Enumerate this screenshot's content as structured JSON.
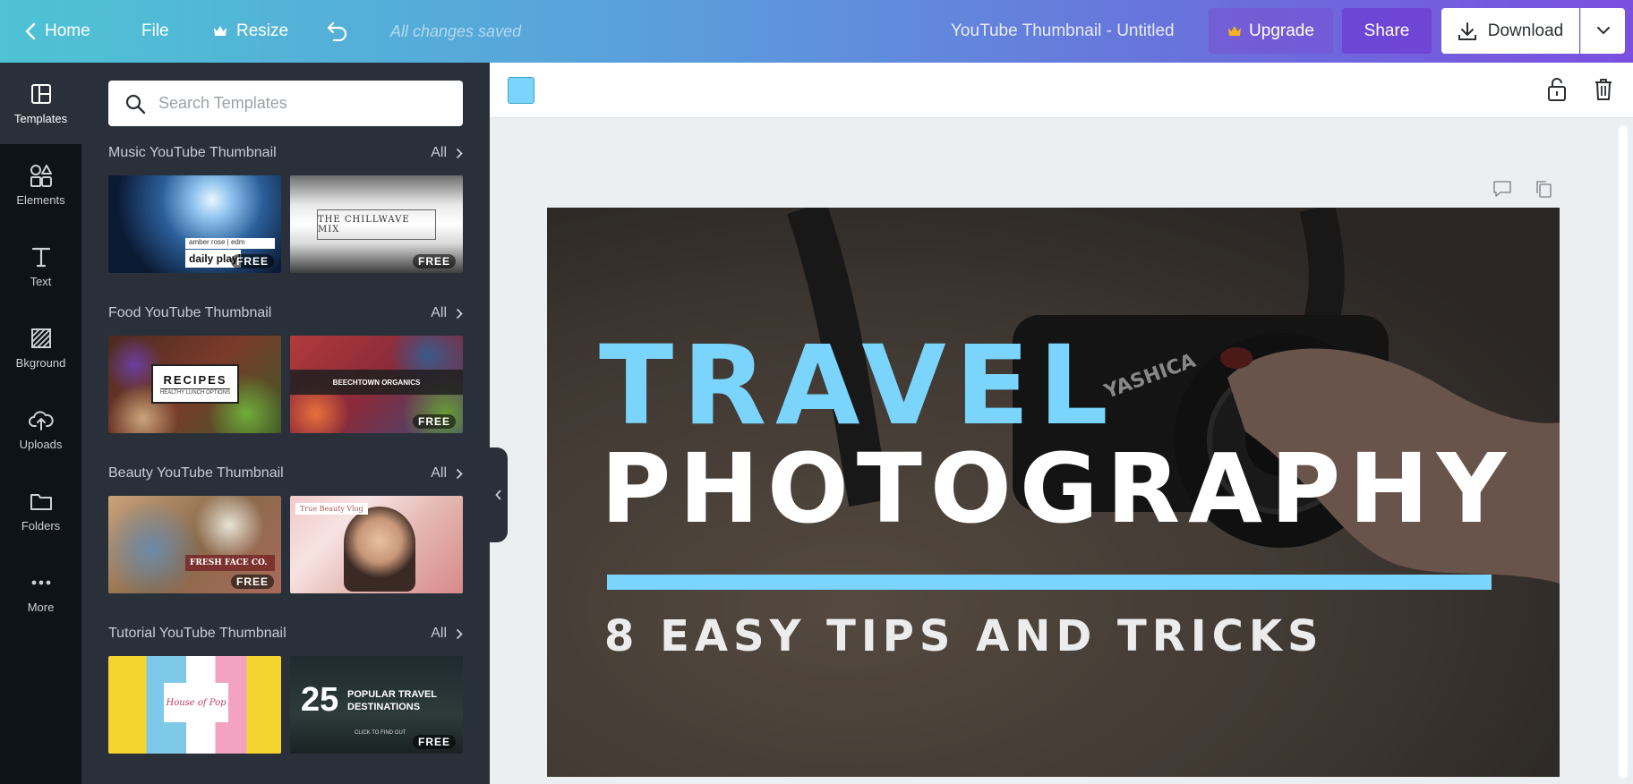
{
  "topbar": {
    "home": "Home",
    "file": "File",
    "resize": "Resize",
    "saved_status": "All changes saved",
    "doc_title": "YouTube Thumbnail - Untitled",
    "upgrade": "Upgrade",
    "share": "Share",
    "download": "Download",
    "gradient": [
      "#4ec3d4",
      "#7b4fe0"
    ]
  },
  "rail": {
    "items": [
      {
        "label": "Templates",
        "icon": "templates-icon",
        "active": true
      },
      {
        "label": "Elements",
        "icon": "elements-icon"
      },
      {
        "label": "Text",
        "icon": "text-icon"
      },
      {
        "label": "Bkground",
        "icon": "background-icon"
      },
      {
        "label": "Uploads",
        "icon": "upload-icon"
      },
      {
        "label": "Folders",
        "icon": "folder-icon"
      },
      {
        "label": "More",
        "icon": "more-icon"
      }
    ]
  },
  "panel": {
    "search_placeholder": "Search Templates",
    "sections": [
      {
        "title": "Music YouTube Thumbnail",
        "all": "All",
        "thumbs": [
          {
            "text": "daily playl",
            "subtext": "amber rose | edm",
            "badge": "FREE"
          },
          {
            "text": "THE CHILLWAVE MIX",
            "badge": "FREE"
          }
        ]
      },
      {
        "title": "Food YouTube Thumbnail",
        "all": "All",
        "thumbs": [
          {
            "text": "RECIPES",
            "subtext": "HEALTHY LUNCH OPTIONS"
          },
          {
            "text": "BEECHTOWN ORGANICS",
            "badge": "FREE"
          }
        ]
      },
      {
        "title": "Beauty YouTube Thumbnail",
        "all": "All",
        "thumbs": [
          {
            "text": "FRESH FACE CO.",
            "badge": "FREE"
          },
          {
            "text": "True Beauty Vlog"
          }
        ]
      },
      {
        "title": "Tutorial YouTube Thumbnail",
        "all": "All",
        "thumbs": [
          {
            "text": "House of Pop"
          },
          {
            "number": "25",
            "text": "POPULAR TRAVEL DESTINATIONS",
            "subtext": "CLICK TO FIND OUT",
            "badge": "FREE"
          }
        ]
      }
    ]
  },
  "editor": {
    "swatch_color": "#7ad4fb",
    "canvas": {
      "headline_1": "TRAVEL",
      "headline_2": "PHOTOGRAPHY",
      "subhead": "8 EASY TIPS AND TRICKS",
      "accent": "#7ad4fb",
      "camera_brand": "YASHICA"
    }
  }
}
